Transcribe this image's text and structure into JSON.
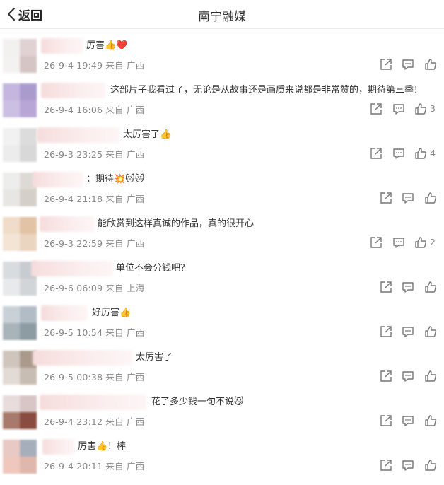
{
  "header": {
    "back_label": "返回",
    "title": "南宁融媒"
  },
  "comments": [
    {
      "text": "厉害👍❤️",
      "meta": "26-9-4 19:49 来自 广西",
      "likes": ""
    },
    {
      "text": "这部片子我看过了，无论是从故事还是画质来说都是非常赞的，期待第三季！",
      "meta": "26-9-4 16:06 来自 广西",
      "likes": "3"
    },
    {
      "text": "太厉害了👍",
      "meta": "26-9-3 23:25 来自 广西",
      "likes": "4"
    },
    {
      "text": "：期待💥😻😻",
      "meta": "26-9-4 21:18 来自 广西",
      "likes": ""
    },
    {
      "text": "能欣赏到这样真诚的作品，真的很开心",
      "meta": "26-9-3 22:59 来自 广西",
      "likes": "2"
    },
    {
      "text": "单位不会分钱吧？",
      "meta": "26-9-6 06:09 来自 上海",
      "likes": ""
    },
    {
      "text": "好厉害👍",
      "meta": "26-9-5 10:54 来自 广西",
      "likes": ""
    },
    {
      "text": "太厉害了",
      "meta": "26-9-5 00:38 来自 广西",
      "likes": ""
    },
    {
      "text": "花了多少钱一句不说😼",
      "meta": "26-9-4 23:12 来自 广西",
      "likes": ""
    },
    {
      "text": "厉害👍！棒",
      "meta": "26-9-4 20:11 来自 广西",
      "likes": ""
    }
  ],
  "icons": {
    "share": "share-icon",
    "reply": "comment-icon",
    "like": "thumbs-up-icon"
  },
  "colors": {
    "meta_text": "#888888",
    "icon": "#777777"
  }
}
